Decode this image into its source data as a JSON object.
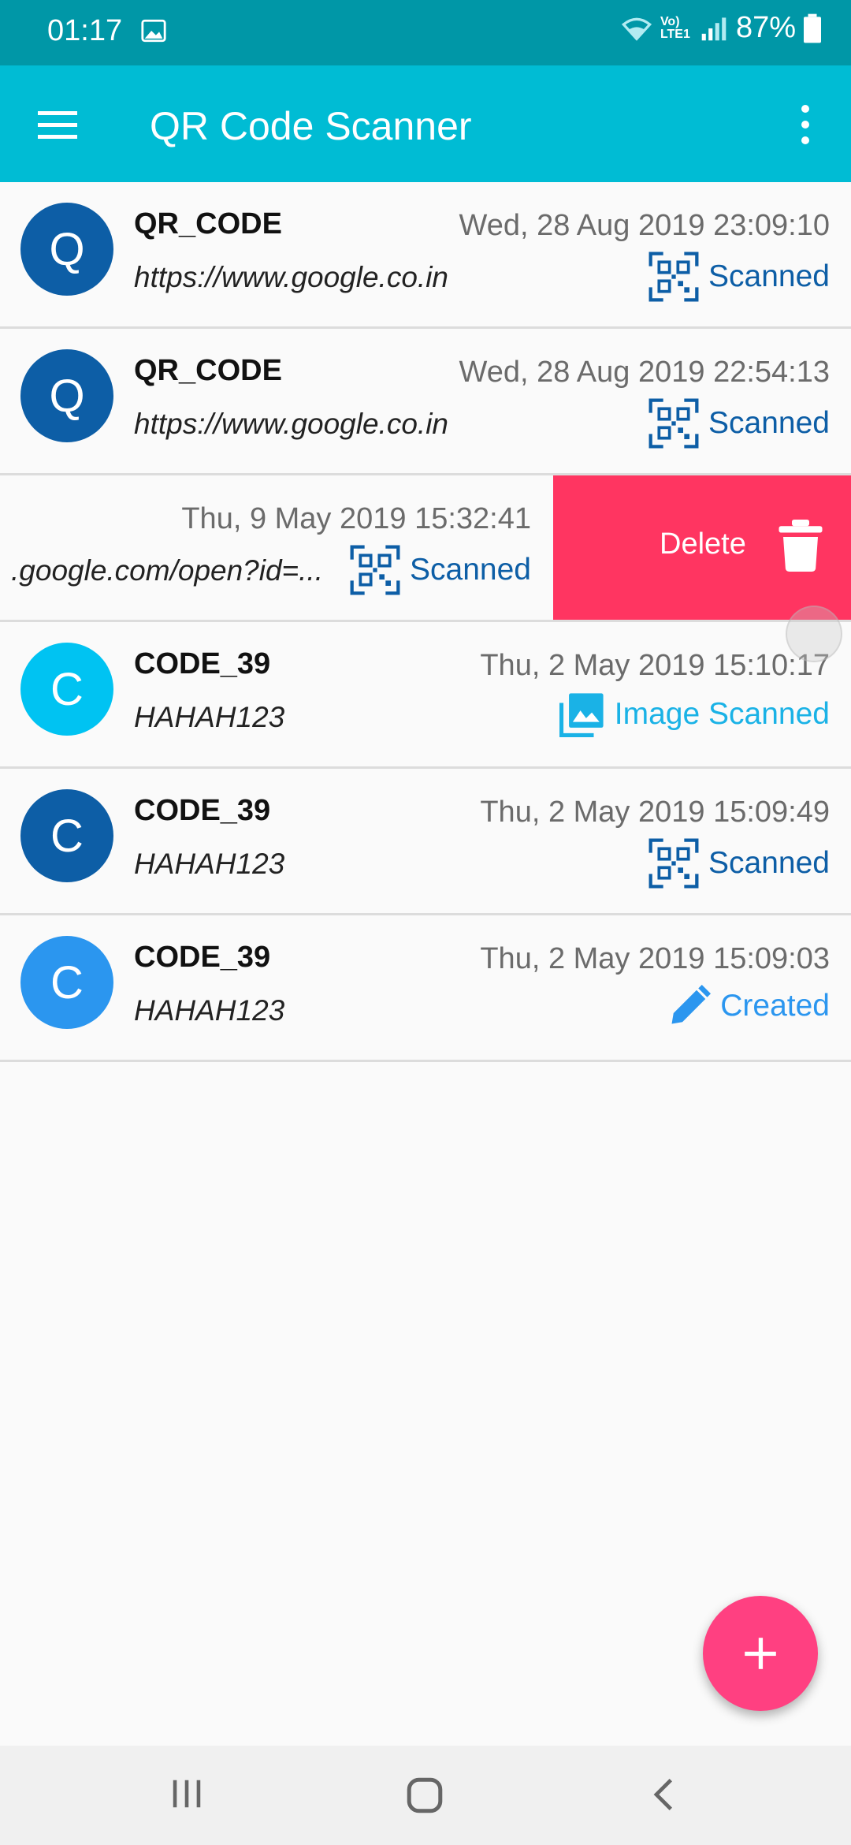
{
  "status_bar": {
    "time": "01:17",
    "network_label": "Vo) LTE1",
    "battery": "87%"
  },
  "app_bar": {
    "title": "QR Code Scanner",
    "left_icon": "menu-icon",
    "right_icon": "overflow-icon"
  },
  "history": [
    {
      "initial": "Q",
      "avatar_color": "#0d5ea6",
      "type": "QR_CODE",
      "value": "https://www.google.co.in",
      "date": "Wed, 28 Aug 2019 23:09:10",
      "status": "Scanned",
      "status_icon": "qr-code-icon",
      "status_color": "#0d5ea6"
    },
    {
      "initial": "Q",
      "avatar_color": "#0d5ea6",
      "type": "QR_CODE",
      "value": "https://www.google.co.in",
      "date": "Wed, 28 Aug 2019 22:54:13",
      "status": "Scanned",
      "status_icon": "qr-code-icon",
      "status_color": "#0d5ea6"
    },
    {
      "value": ".google.com/open?id=...",
      "date": "Thu, 9 May 2019 15:32:41",
      "status": "Scanned",
      "status_icon": "qr-code-icon",
      "status_color": "#0d5ea6",
      "delete_label": "Delete"
    },
    {
      "initial": "C",
      "avatar_color": "#00c3f2",
      "type": "CODE_39",
      "value": "HAHAH123",
      "date": "Thu, 2 May 2019 15:10:17",
      "status": "Image Scanned",
      "status_icon": "image-icon",
      "status_color": "#1ab2e6"
    },
    {
      "initial": "C",
      "avatar_color": "#0d5ea6",
      "type": "CODE_39",
      "value": "HAHAH123",
      "date": "Thu, 2 May 2019 15:09:49",
      "status": "Scanned",
      "status_icon": "qr-code-icon",
      "status_color": "#0d5ea6"
    },
    {
      "initial": "C",
      "avatar_color": "#2b96ef",
      "type": "CODE_39",
      "value": "HAHAH123",
      "date": "Thu, 2 May 2019 15:09:03",
      "status": "Created",
      "status_icon": "pencil-icon",
      "status_color": "#2b96ef"
    }
  ],
  "fab": {
    "icon": "plus-icon",
    "color": "#ff4081"
  },
  "colors": {
    "status_bar": "#0097a7",
    "app_bar": "#00bcd4",
    "delete": "#ff3561"
  }
}
